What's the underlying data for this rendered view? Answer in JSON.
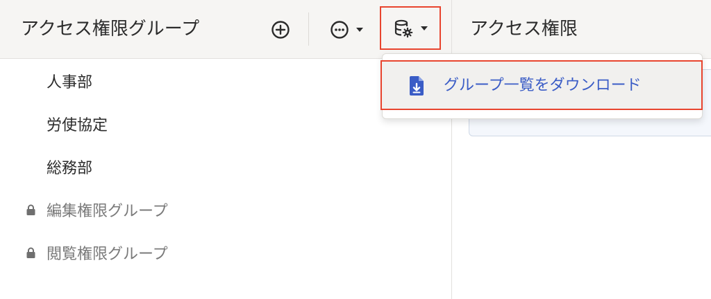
{
  "left_panel": {
    "title": "アクセス権限グループ",
    "toolbar": {
      "add_icon": "plus-circle-icon",
      "more_icon": "ellipsis-circle-icon",
      "db_icon": "database-settings-icon"
    },
    "groups": [
      {
        "label": "人事部",
        "locked": false
      },
      {
        "label": "労使協定",
        "locked": false
      },
      {
        "label": "総務部",
        "locked": false
      },
      {
        "label": "編集権限グループ",
        "locked": true
      },
      {
        "label": "閲覧権限グループ",
        "locked": true
      }
    ]
  },
  "right_panel": {
    "title": "アクセス権限"
  },
  "dropdown": {
    "items": [
      {
        "label": "グループ一覧をダウンロード",
        "icon": "file-download-icon"
      }
    ]
  },
  "colors": {
    "header_bg": "#f6f5f3",
    "highlight": "#e8442e",
    "link_blue": "#3a5cc6"
  }
}
